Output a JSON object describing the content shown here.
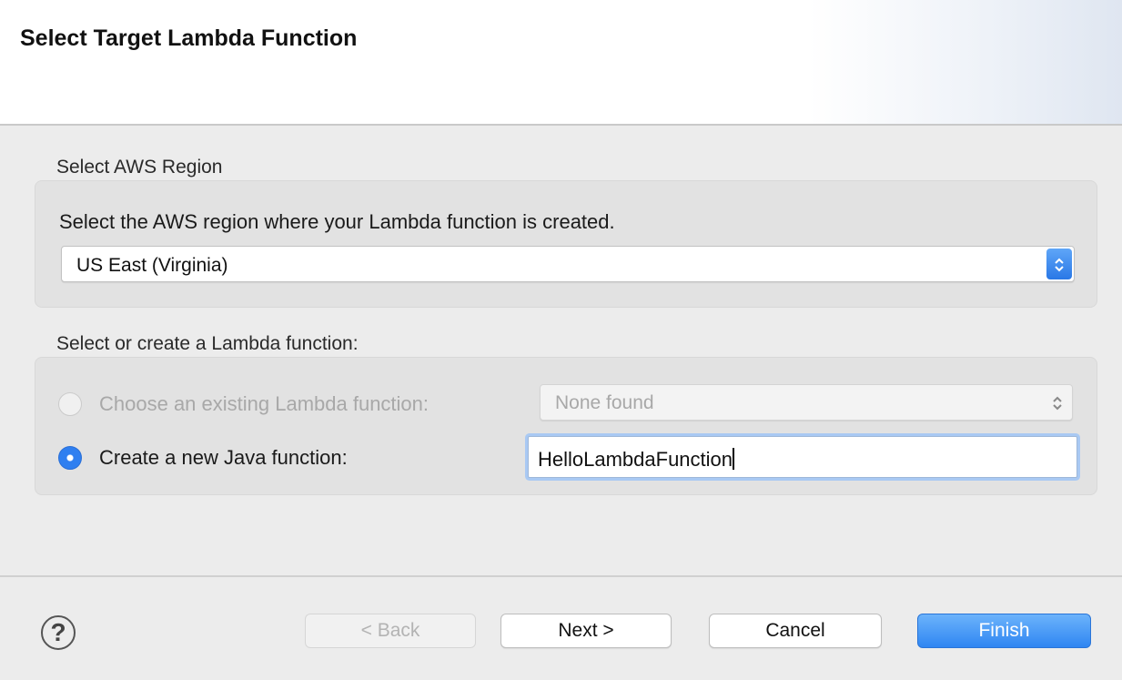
{
  "header": {
    "title": "Select Target Lambda Function"
  },
  "region_group": {
    "label": "Select AWS Region",
    "description": "Select the AWS region where your Lambda function is created.",
    "selected_region": "US East (Virginia)"
  },
  "function_group": {
    "label": "Select or create a Lambda function:",
    "existing_option_label": "Choose an existing Lambda function:",
    "existing_select_value": "None found",
    "new_option_label": "Create a new Java function:",
    "new_function_name": "HelloLambdaFunction",
    "selected_option": "new"
  },
  "footer": {
    "help_icon": "question-circle-icon",
    "back_label": "< Back",
    "next_label": "Next >",
    "cancel_label": "Cancel",
    "finish_label": "Finish"
  },
  "colors": {
    "accent": "#2f86f2",
    "background": "#ececec"
  }
}
